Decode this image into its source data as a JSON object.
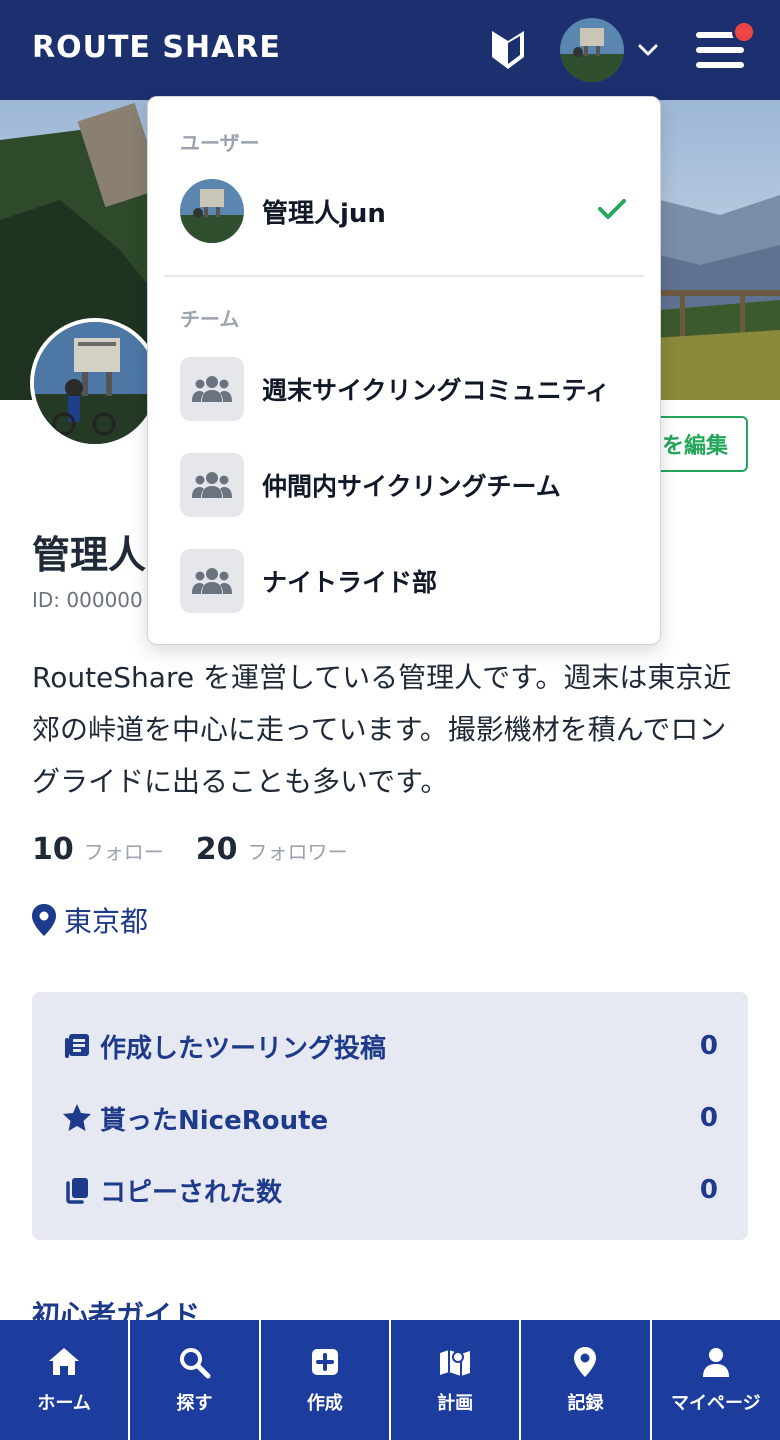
{
  "header": {
    "logo_text": "ROUTE SHARE",
    "brand_color": "#1c2f6e",
    "notification_color": "#ef4444"
  },
  "profile": {
    "name": "管理人",
    "id_text": "ID: 000000",
    "edit_button_label": "を編集",
    "bio": "RouteShare を運営している管理人です。週末は東京近郊の峠道を中心に走っています。撮影機材を積んでロングライドに出ることも多いです。",
    "follow_count": "10",
    "follow_label": "フォロー",
    "follower_count": "20",
    "follower_label": "フォロワー",
    "location": "東京都"
  },
  "summary": {
    "items": [
      {
        "label": "作成したツーリング投稿",
        "value": "0",
        "icon": "post-icon"
      },
      {
        "label": "貰ったNiceRoute",
        "value": "0",
        "icon": "star-icon"
      },
      {
        "label": "コピーされた数",
        "value": "0",
        "icon": "copy-icon"
      }
    ]
  },
  "guide_link": "初心者ガイド",
  "dropdown": {
    "user_section": "ユーザー",
    "user_name": "管理人jun",
    "team_section": "チーム",
    "teams": [
      {
        "name": "週末サイクリングコミュニティ"
      },
      {
        "name": "仲間内サイクリングチーム"
      },
      {
        "name": "ナイトライド部"
      }
    ]
  },
  "bottom_nav": {
    "items": [
      {
        "label": "ホーム",
        "icon": "home-icon"
      },
      {
        "label": "探す",
        "icon": "search-icon"
      },
      {
        "label": "作成",
        "icon": "plus-square-icon"
      },
      {
        "label": "計画",
        "icon": "map-icon"
      },
      {
        "label": "記録",
        "icon": "pin-icon"
      },
      {
        "label": "マイページ",
        "icon": "user-icon"
      }
    ]
  }
}
